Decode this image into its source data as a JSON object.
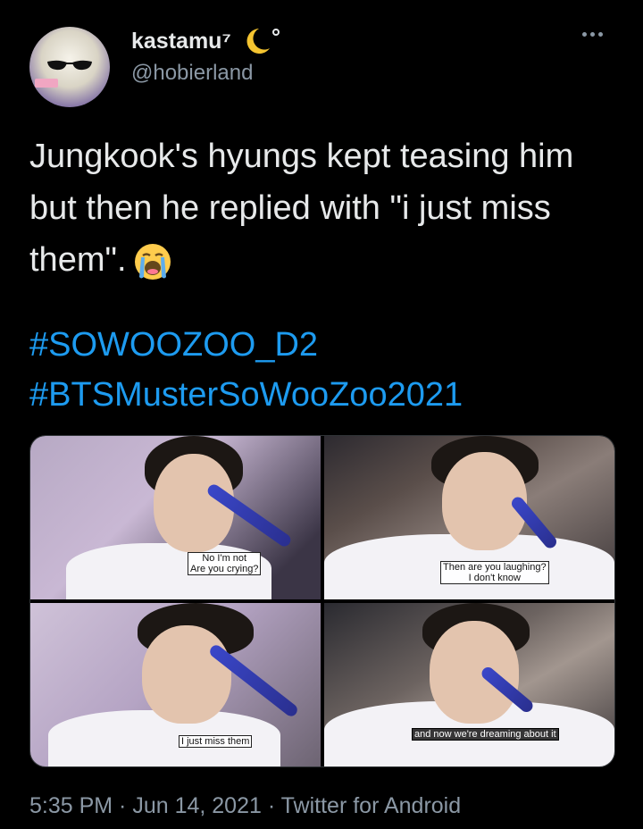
{
  "tweet": {
    "display_name": "kastamu⁷",
    "handle": "@hobierland",
    "text": "Jungkook's hyungs kept teasing him but then he replied with \"i just miss them\".",
    "hashtags": [
      "#SOWOOZOO_D2",
      "#BTSMusterSoWooZoo2021"
    ],
    "timestamp": "5:35 PM · Jun 14, 2021 · Twitter for Android"
  },
  "media": {
    "panels": [
      {
        "subtitle_lines": [
          "No I'm not",
          "Are you crying?"
        ]
      },
      {
        "subtitle_lines": [
          "Then are you laughing?",
          "I don't know"
        ]
      },
      {
        "subtitle_lines": [
          "I just miss them"
        ]
      },
      {
        "subtitle_lines": [
          "and now we're dreaming about it"
        ]
      }
    ]
  },
  "icons": {
    "avatar": "avatar-image",
    "moon": "crescent-moon-icon",
    "more": "more-options-icon",
    "emoji": "loudly-crying-face-emoji"
  },
  "colors": {
    "background": "#000000",
    "text": "#e7e9ea",
    "secondary": "#8b98a5",
    "accent": "#1d9bf0"
  }
}
